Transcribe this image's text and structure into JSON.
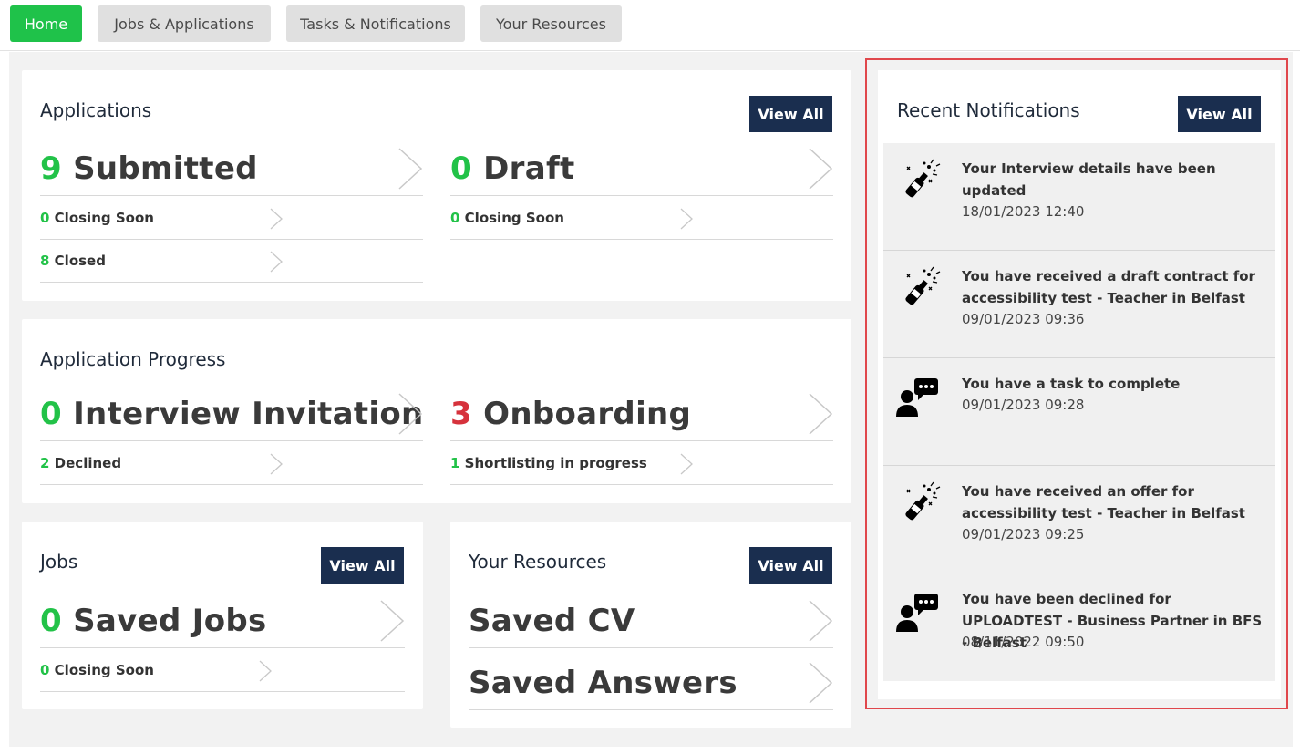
{
  "nav": {
    "tabs": [
      {
        "label": "Home",
        "active": true
      },
      {
        "label": "Jobs & Applications",
        "active": false
      },
      {
        "label": "Tasks & Notifications",
        "active": false
      },
      {
        "label": "Your Resources",
        "active": false
      }
    ]
  },
  "applications": {
    "title": "Applications",
    "view_all": "View All",
    "submitted": {
      "count": "9",
      "label": "Submitted"
    },
    "draft": {
      "count": "0",
      "label": "Draft"
    },
    "submitted_closing_soon": {
      "count": "0",
      "label": "Closing Soon"
    },
    "submitted_closed": {
      "count": "8",
      "label": "Closed"
    },
    "draft_closing_soon": {
      "count": "0",
      "label": "Closing Soon"
    }
  },
  "progress": {
    "title": "Application Progress",
    "interview": {
      "count": "0",
      "label": "Interview Invitation"
    },
    "onboarding": {
      "count": "3",
      "label": "Onboarding"
    },
    "declined": {
      "count": "2",
      "label": "Declined"
    },
    "shortlisting": {
      "count": "1",
      "label": "Shortlisting in progress"
    }
  },
  "jobs": {
    "title": "Jobs",
    "view_all": "View All",
    "saved": {
      "count": "0",
      "label": "Saved Jobs"
    },
    "closing_soon": {
      "count": "0",
      "label": "Closing Soon"
    }
  },
  "resources": {
    "title": "Your Resources",
    "view_all": "View All",
    "saved_cv": "Saved CV",
    "saved_answers": "Saved Answers"
  },
  "notifications": {
    "title": "Recent Notifications",
    "view_all": "View All",
    "items": [
      {
        "icon": "celebration-icon",
        "text": "Your Interview details have been updated",
        "date": "18/01/2023 12:40"
      },
      {
        "icon": "celebration-icon",
        "text": "You have received a draft contract for accessibility test - Teacher in Belfast",
        "date": "09/01/2023 09:36"
      },
      {
        "icon": "chat-user-icon",
        "text": "You have a task to complete",
        "date": "09/01/2023 09:28"
      },
      {
        "icon": "celebration-icon",
        "text": "You have received an offer for accessibility test - Teacher in Belfast",
        "date": "09/01/2023 09:25"
      },
      {
        "icon": "chat-user-icon",
        "text": "You have been declined for UPLOADTEST - Business Partner in BFS - Belfast",
        "date": "08/11/2022 09:50"
      }
    ]
  },
  "colors": {
    "accent_green": "#1fc24a",
    "button_navy": "#1a2e4f",
    "highlight_red": "#e0474c",
    "onboarding_red": "#d6323c"
  }
}
